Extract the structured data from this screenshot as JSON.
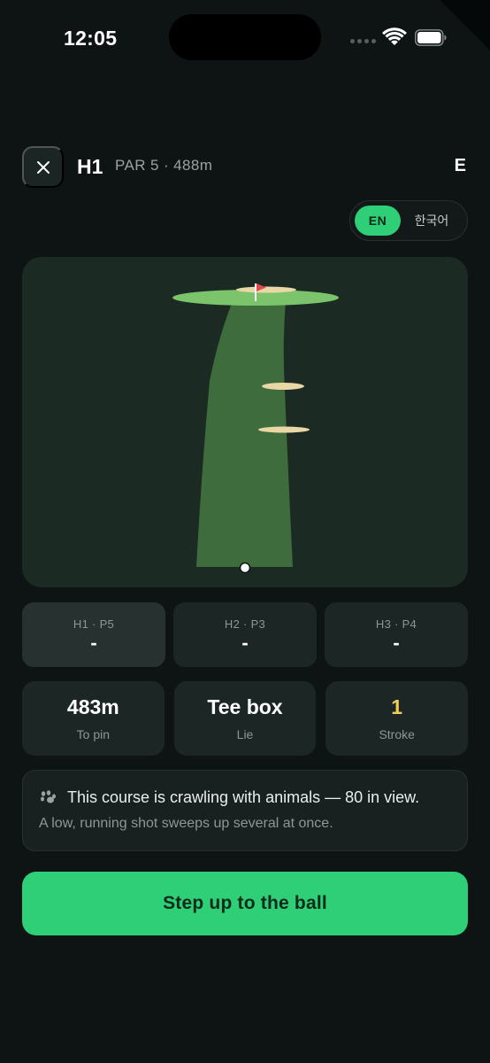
{
  "status_bar": {
    "time": "12:05"
  },
  "header": {
    "close_icon": "close-icon",
    "hole_id": "H1",
    "hole_meta": "PAR 5 · 488m",
    "score_to_par": "E"
  },
  "language": {
    "options": [
      "EN",
      "한국어"
    ],
    "selected": "EN"
  },
  "map": {
    "pin_flag_color": "#e04a4a",
    "fairway_color": "#3f6c3c",
    "green_color": "#7bc46b",
    "bunker_color": "#ead7a6"
  },
  "holes": [
    {
      "label": "H1 · P5",
      "score": "-"
    },
    {
      "label": "H2 · P3",
      "score": "-"
    },
    {
      "label": "H3 · P4",
      "score": "-"
    }
  ],
  "stats": [
    {
      "value": "483m",
      "label": "To pin"
    },
    {
      "value": "Tee box",
      "label": "Lie"
    },
    {
      "value": "1",
      "label": "Stroke"
    }
  ],
  "info": {
    "icon": "paw-icon",
    "line1": "This course is crawling with animals — 80 in view.",
    "line2": "A low, running shot sweeps up several at once."
  },
  "cta": {
    "label": "Step up to the ball"
  },
  "colors": {
    "accent": "#2fcf78",
    "background": "#0e1413",
    "stroke_highlight": "#f3ce57"
  }
}
